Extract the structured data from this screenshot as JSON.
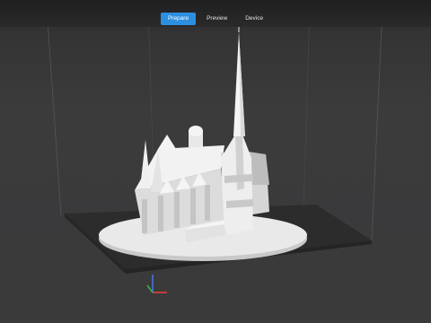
{
  "tabs": [
    {
      "label": "Prepare",
      "active": true
    },
    {
      "label": "Preview",
      "active": false
    },
    {
      "label": "Device",
      "active": false
    }
  ],
  "colors": {
    "accent": "#2d8fe0",
    "background": "#3b3b3c",
    "build_plate": "#2e2e2f",
    "model": "#e8e8e8",
    "axis_x": "#e0413a",
    "axis_y": "#3fb24a",
    "axis_z": "#4a6fe0"
  },
  "icons": {
    "axis_gizmo": "axis-triad-icon"
  }
}
